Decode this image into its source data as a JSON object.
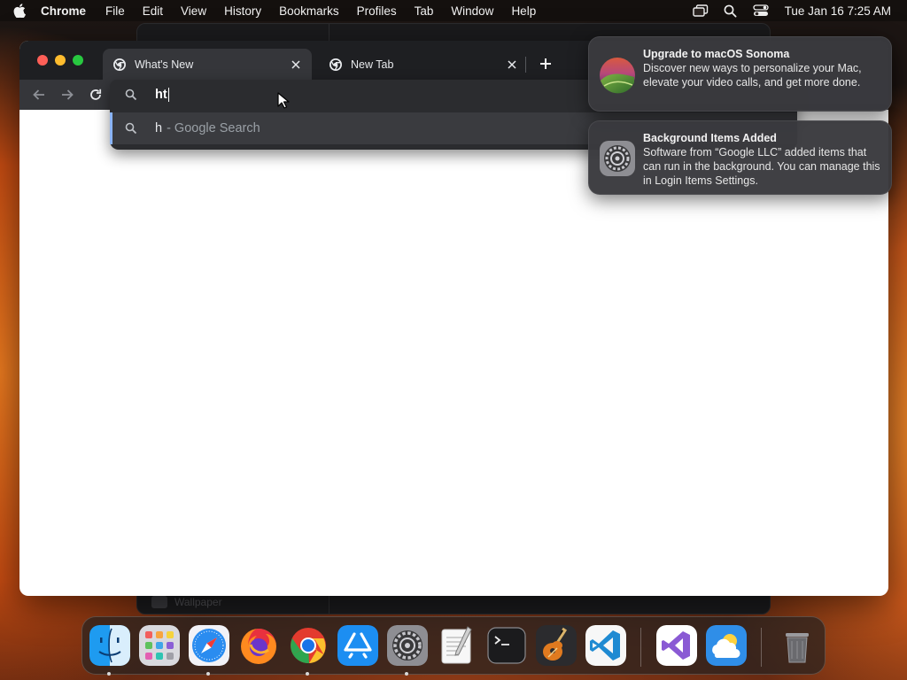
{
  "menubar": {
    "apple_icon": "apple-logo-icon",
    "app_name": "Chrome",
    "items": [
      "File",
      "Edit",
      "View",
      "History",
      "Bookmarks",
      "Profiles",
      "Tab",
      "Window",
      "Help"
    ],
    "status_icons": [
      "screen-mirroring-icon",
      "spotlight-search-icon",
      "control-center-icon"
    ],
    "clock": "Tue Jan 16  7:25 AM"
  },
  "background_window": {
    "sidebar_item": "Wallpaper"
  },
  "browser": {
    "tabs": [
      {
        "label": "What's New",
        "active": true,
        "icon": "chrome-icon"
      },
      {
        "label": "New Tab",
        "active": false,
        "icon": "chrome-icon"
      }
    ],
    "omnibox": {
      "typed_text": "ht",
      "suggestion_query": "h",
      "suggestion_detail": "- Google Search"
    }
  },
  "notifications": [
    {
      "title": "Upgrade to macOS Sonoma",
      "body": "Discover new ways to personalize your Mac, elevate your video calls, and get more done.",
      "icon": "macos-sonoma-icon"
    },
    {
      "title": "Background Items Added",
      "body": "Software from “Google LLC” added items that can run in the background. You can manage this in Login Items Settings.",
      "icon": "system-settings-icon"
    }
  ],
  "dock": {
    "apps": [
      "Finder",
      "Launchpad",
      "Safari",
      "Firefox",
      "Google Chrome",
      "App Store",
      "System Settings",
      "TextEdit",
      "Terminal",
      "GarageBand",
      "Visual Studio Code",
      "Visual Studio",
      "Weather",
      "Trash"
    ],
    "running": [
      "Finder",
      "Safari",
      "Google Chrome",
      "System Settings"
    ],
    "colors": {
      "accent_blue": "#8ab4f8",
      "tab_strip": "#1e1f22",
      "toolbar": "#35363a"
    }
  }
}
